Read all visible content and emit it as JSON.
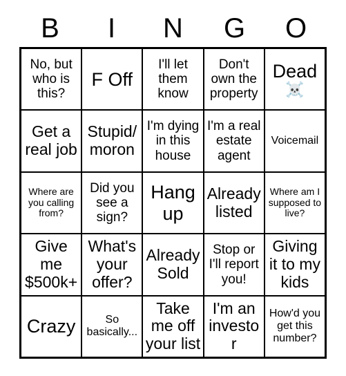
{
  "header": {
    "letters": [
      "B",
      "I",
      "N",
      "G",
      "O"
    ]
  },
  "colors": {
    "background": "#ffffff",
    "border": "#000000",
    "text": "#000000"
  },
  "grid": {
    "rows": 5,
    "columns": 5,
    "cells": [
      [
        {
          "text": "No, but who is this?",
          "size": "md",
          "emoji": ""
        },
        {
          "text": "F Off",
          "size": "xl",
          "emoji": ""
        },
        {
          "text": "I'll let them know",
          "size": "md",
          "emoji": ""
        },
        {
          "text": "Don't own the property",
          "size": "md",
          "emoji": ""
        },
        {
          "text": "Dead",
          "size": "xl",
          "emoji": "☠️"
        }
      ],
      [
        {
          "text": "Get a real job",
          "size": "lg",
          "emoji": ""
        },
        {
          "text": "Stupid/ moron",
          "size": "lg",
          "emoji": ""
        },
        {
          "text": "I'm dying in this house",
          "size": "md",
          "emoji": ""
        },
        {
          "text": "I'm a real estate agent",
          "size": "md",
          "emoji": ""
        },
        {
          "text": "Voicemail",
          "size": "sm",
          "emoji": ""
        }
      ],
      [
        {
          "text": "Where are you calling from?",
          "size": "xs",
          "emoji": ""
        },
        {
          "text": "Did you see a sign?",
          "size": "md",
          "emoji": ""
        },
        {
          "text": "Hang up",
          "size": "xl",
          "emoji": ""
        },
        {
          "text": "Already listed",
          "size": "lg",
          "emoji": ""
        },
        {
          "text": "Where am I supposed to live?",
          "size": "xs",
          "emoji": ""
        }
      ],
      [
        {
          "text": "Give me $500k+",
          "size": "lg",
          "emoji": ""
        },
        {
          "text": "What's your offer?",
          "size": "lg",
          "emoji": ""
        },
        {
          "text": "Already Sold",
          "size": "lg",
          "emoji": ""
        },
        {
          "text": "Stop or I'll report you!",
          "size": "md",
          "emoji": ""
        },
        {
          "text": "Giving it to my kids",
          "size": "lg",
          "emoji": ""
        }
      ],
      [
        {
          "text": "Crazy",
          "size": "xl",
          "emoji": ""
        },
        {
          "text": "So basically...",
          "size": "sm",
          "emoji": ""
        },
        {
          "text": "Take me off your list",
          "size": "lg",
          "emoji": ""
        },
        {
          "text": "I'm an investor",
          "size": "lg",
          "emoji": ""
        },
        {
          "text": "How'd you get this number?",
          "size": "sm",
          "emoji": ""
        }
      ]
    ]
  }
}
